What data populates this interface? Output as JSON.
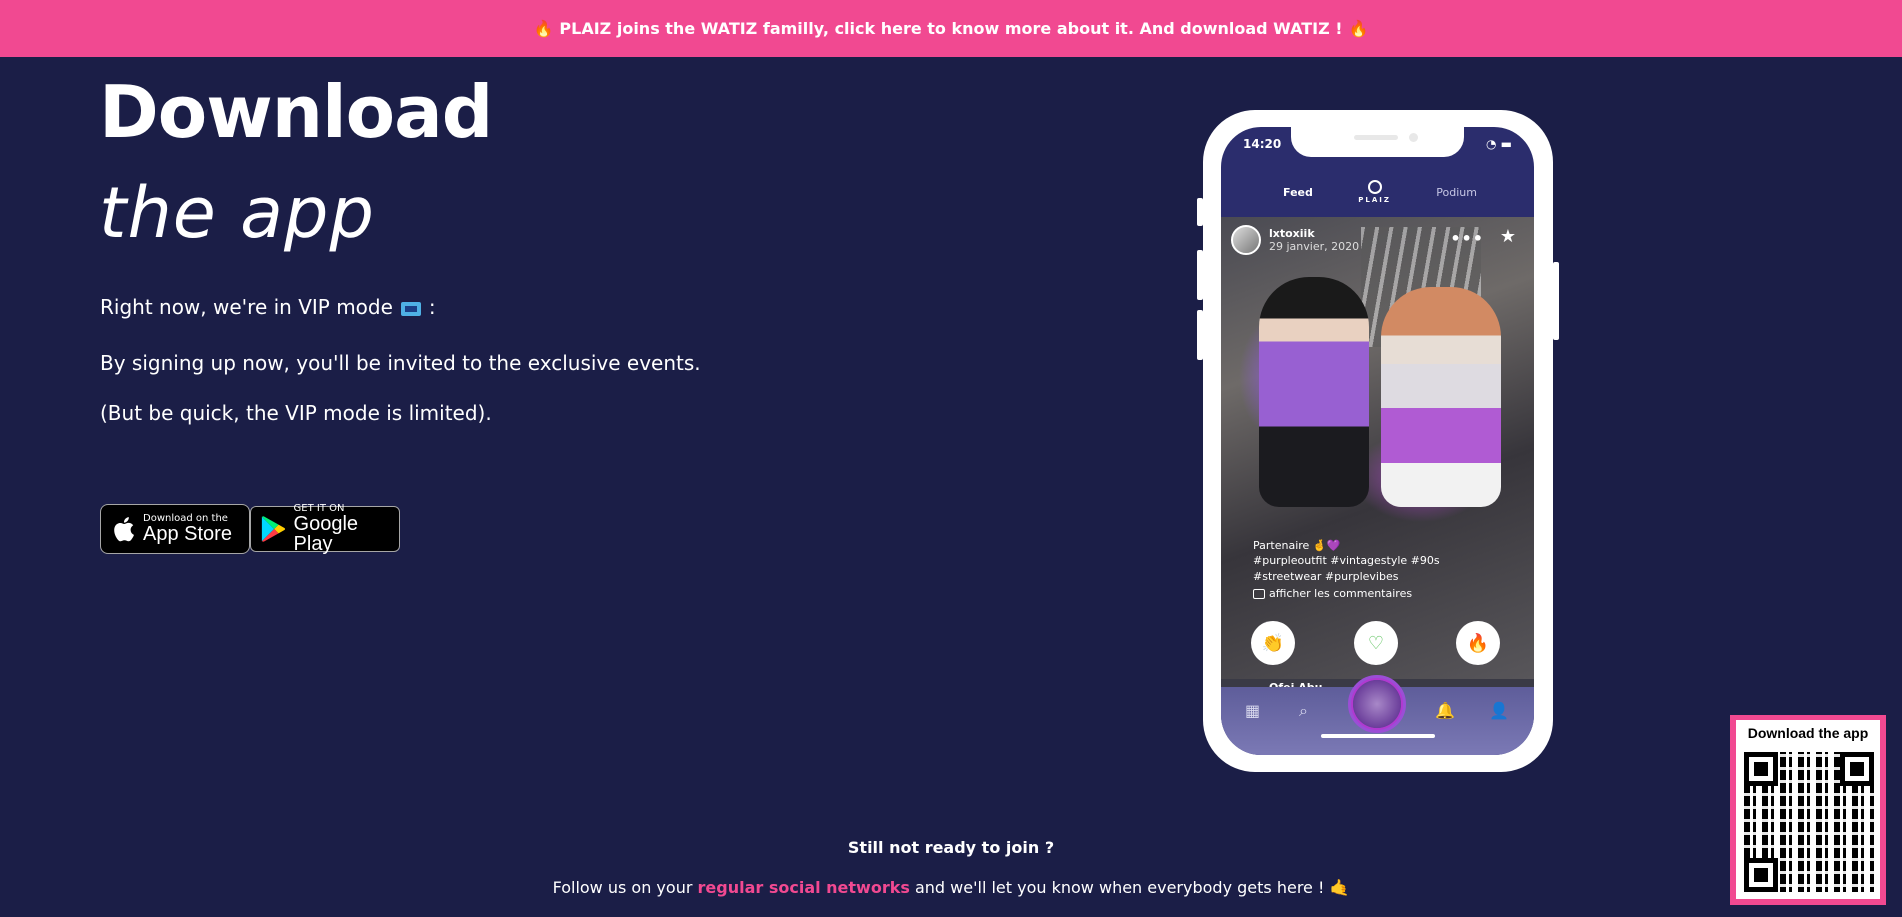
{
  "banner": {
    "text": "PLAIZ joins the WATIZ familly, click here to know more about it. And download WATIZ !",
    "icon": "fire-icon"
  },
  "hero": {
    "title": "Download",
    "subtitle": "the app"
  },
  "vip": {
    "line1_before": "Right now, we're in VIP mode",
    "line1_after": ":",
    "line2": "By signing up now, you'll be invited to the exclusive events.",
    "line3": "(But be quick, the VIP mode is limited)."
  },
  "stores": {
    "apple": {
      "small": "Download on the",
      "big": "App Store"
    },
    "google": {
      "small": "GET IT ON",
      "big": "Google Play"
    }
  },
  "phone": {
    "time": "14:20",
    "tabs": {
      "feed": "Feed",
      "logo": "PLAIZ",
      "podium": "Podium"
    },
    "post": {
      "user": "lxtoxiik",
      "date": "29 janvier, 2020",
      "caption_line1": "Partenaire 🤞💜",
      "caption_line2": "#purpleoutfit #vintagestyle #90s",
      "caption_line3": "#streetwear #purplevibes",
      "comments": "afficher les commentaires"
    },
    "next_user": "Ofei Abu"
  },
  "footer": {
    "title": "Still not ready to join ?",
    "text_before": "Follow us on your",
    "link": "regular social networks",
    "text_after": "and we'll let you know when everybody gets here !"
  },
  "qr": {
    "label": "Download the app"
  },
  "colors": {
    "background": "#1b1e47",
    "accent": "#f14991"
  }
}
